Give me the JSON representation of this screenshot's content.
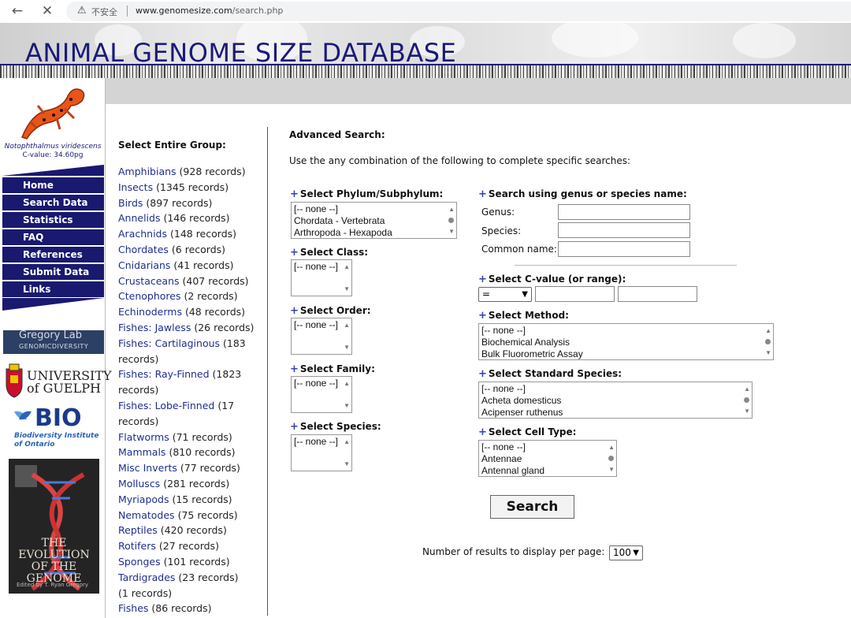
{
  "browser": {
    "security_label": "不安全",
    "url_domain": "www.genomesize.com",
    "url_path": "/search.php"
  },
  "banner": {
    "title": "ANIMAL GENOME SIZE DATABASE"
  },
  "sidebar": {
    "species_name": "Notophthalmus viridescens",
    "c_value": "C-value: 34.60pg",
    "nav": [
      {
        "label": "Home"
      },
      {
        "label": "Search Data"
      },
      {
        "label": "Statistics"
      },
      {
        "label": "FAQ"
      },
      {
        "label": "References"
      },
      {
        "label": "Submit Data"
      },
      {
        "label": "Links"
      }
    ],
    "gregory_lab": "Gregory Lab",
    "gregory_sub": "GENOMICDIVERSITY",
    "guelph_line1": "UNIVERSITY",
    "guelph_line2": "of GUELPH",
    "bio_logo": "BIO",
    "bio_line1": "Biodiversity Institute",
    "bio_line2": "of Ontario",
    "book_title": "THE EVOLUTION OF THE GENOME",
    "book_author": "Edited by T. Ryan Gregory"
  },
  "groups": {
    "heading": "Select Entire Group:",
    "items": [
      {
        "name": "Amphibians",
        "count": "(928 records)"
      },
      {
        "name": "Insects",
        "count": "(1345 records)"
      },
      {
        "name": "Birds",
        "count": "(897 records)"
      },
      {
        "name": "Annelids",
        "count": "(146 records)"
      },
      {
        "name": "Arachnids",
        "count": "(148 records)"
      },
      {
        "name": "Chordates",
        "count": "(6 records)"
      },
      {
        "name": "Cnidarians",
        "count": "(41 records)"
      },
      {
        "name": "Crustaceans",
        "count": "(407 records)"
      },
      {
        "name": "Ctenophores",
        "count": "(2 records)"
      },
      {
        "name": "Echinoderms",
        "count": "(48 records)"
      },
      {
        "name": "Fishes: Jawless",
        "count": "(26 records)"
      },
      {
        "name": "Fishes: Cartilaginous",
        "count": "(183 records)"
      },
      {
        "name": "Fishes: Ray-Finned",
        "count": "(1823 records)"
      },
      {
        "name": "Fishes: Lobe-Finned",
        "count": "(17 records)"
      },
      {
        "name": "Flatworms",
        "count": "(71 records)"
      },
      {
        "name": "Mammals",
        "count": "(810 records)"
      },
      {
        "name": "Misc Inverts",
        "count": "(77 records)"
      },
      {
        "name": "Molluscs",
        "count": "(281 records)"
      },
      {
        "name": "Myriapods",
        "count": "(15 records)"
      },
      {
        "name": "Nematodes",
        "count": "(75 records)"
      },
      {
        "name": "Reptiles",
        "count": "(420 records)"
      },
      {
        "name": "Rotifers",
        "count": "(27 records)"
      },
      {
        "name": "Sponges",
        "count": "(101 records)"
      },
      {
        "name": "Tardigrades",
        "count": "(23 records)"
      },
      {
        "name": "",
        "count": "(1 records)"
      },
      {
        "name": "Fishes",
        "count": "(86 records)"
      }
    ]
  },
  "search": {
    "heading": "Advanced Search:",
    "intro": "Use the any combination of the following to complete specific searches:",
    "phylum": {
      "label": "Select Phylum/Subphylum:",
      "options": [
        "[-- none --]",
        "Chordata - Vertebrata",
        "Arthropoda - Hexapoda"
      ]
    },
    "class": {
      "label": "Select Class:",
      "options": [
        "[-- none --]"
      ]
    },
    "order": {
      "label": "Select Order:",
      "options": [
        "[-- none --]"
      ]
    },
    "family": {
      "label": "Select Family:",
      "options": [
        "[-- none --]"
      ]
    },
    "species": {
      "label": "Select Species:",
      "options": [
        "[-- none --]"
      ]
    },
    "name_search": {
      "label": "Search using genus or species name:",
      "genus": "Genus:",
      "species": "Species:",
      "common": "Common name:"
    },
    "cvalue": {
      "label": "Select C-value (or range):",
      "operator": "="
    },
    "method": {
      "label": "Select Method:",
      "options": [
        "[-- none --]",
        "Biochemical Analysis",
        "Bulk Fluorometric Assay"
      ]
    },
    "standard": {
      "label": "Select Standard Species:",
      "options": [
        "[-- none --]",
        "Acheta domesticus",
        "Acipenser ruthenus"
      ]
    },
    "celltype": {
      "label": "Select Cell Type:",
      "options": [
        "[-- none --]",
        "Antennae",
        "Antennal gland"
      ]
    },
    "button": "Search",
    "perpage_label": "Number of results to display per page:",
    "perpage_value": "100"
  }
}
